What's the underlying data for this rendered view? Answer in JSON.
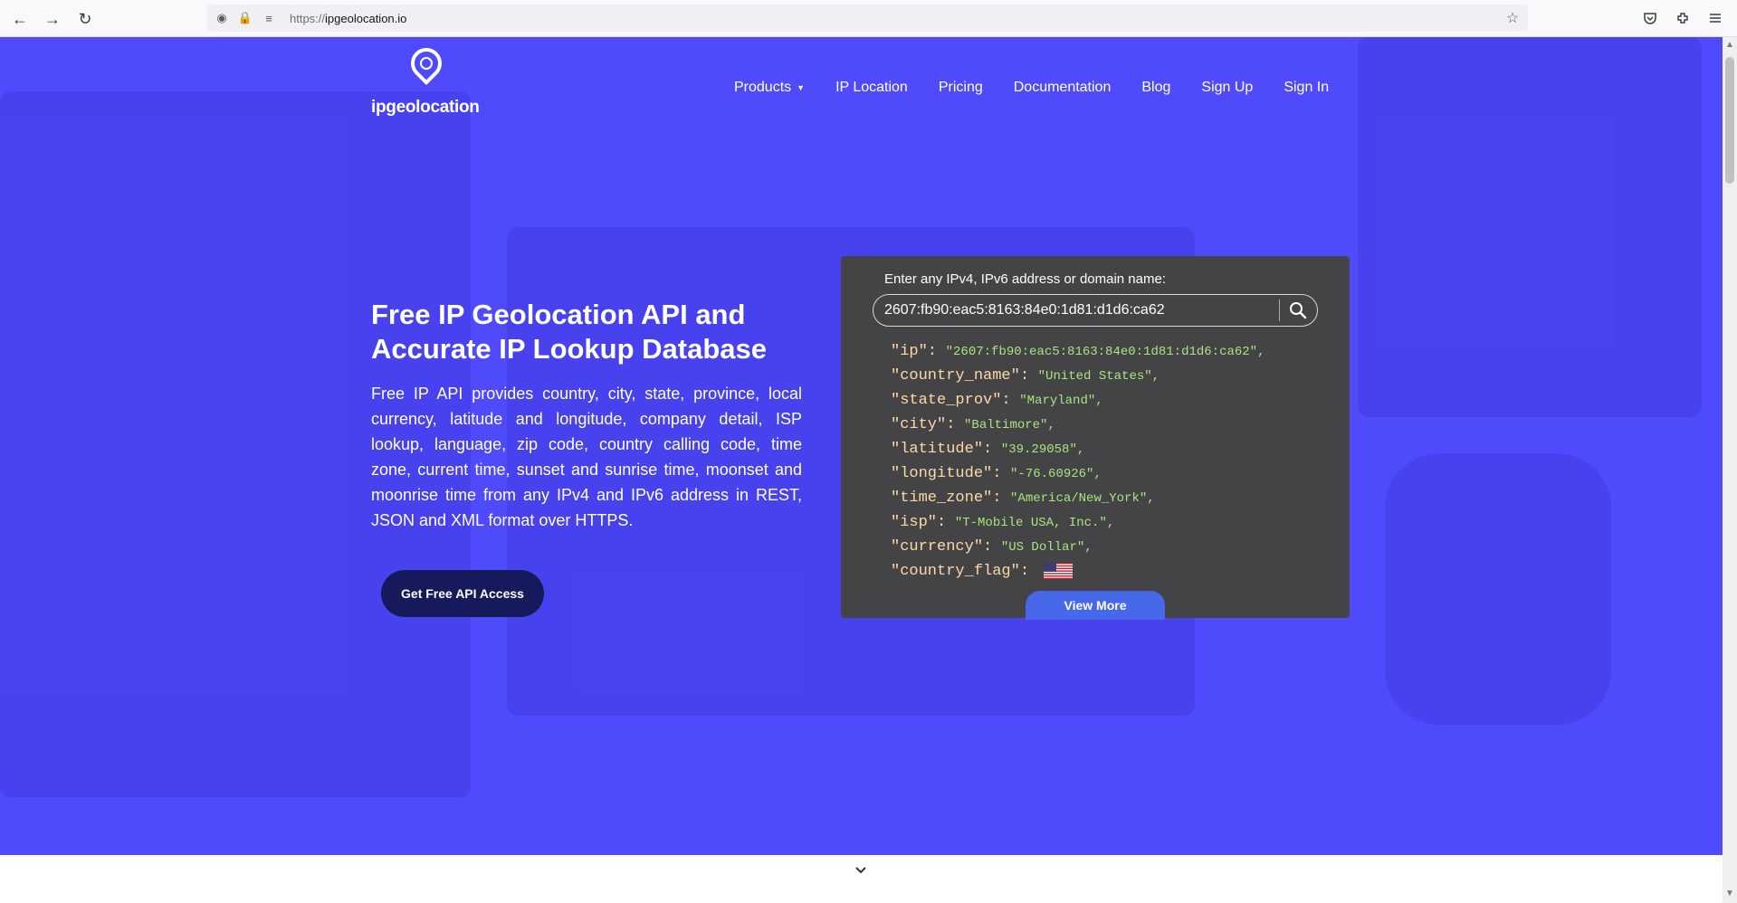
{
  "browser": {
    "url_protocol": "https://",
    "url_domain": "ipgeolocation.io",
    "icons": [
      "back-icon",
      "forward-icon",
      "reload-icon",
      "shield-icon",
      "lock-icon",
      "permissions-icon",
      "bookmark-star-icon",
      "pocket-icon",
      "extensions-icon",
      "menu-icon"
    ]
  },
  "site": {
    "logo_text": "ipgeolocation",
    "nav": {
      "products": "Products",
      "ip_location": "IP Location",
      "pricing": "Pricing",
      "documentation": "Documentation",
      "blog": "Blog",
      "sign_up": "Sign Up",
      "sign_in": "Sign In"
    }
  },
  "hero": {
    "title": "Free IP Geolocation API and Accurate IP Lookup Database",
    "description": "Free IP API provides country, city, state, province, local currency, latitude and longitude, company detail, ISP lookup, language, zip code, country calling code, time zone, current time, sunset and sunrise time, moonset and moonrise time from any IPv4 and IPv6 address in REST, JSON and XML format over HTTPS.",
    "cta_label": "Get Free API Access"
  },
  "lookup": {
    "label": "Enter any IPv4, IPv6 address or domain name:",
    "value": "2607:fb90:eac5:8163:84e0:1d81:d1d6:ca62",
    "result": [
      {
        "key": "\"ip\":",
        "value": "\"2607:fb90:eac5:8163:84e0:1d81:d1d6:ca62\","
      },
      {
        "key": "\"country_name\":",
        "value": "\"United States\","
      },
      {
        "key": "\"state_prov\":",
        "value": "\"Maryland\","
      },
      {
        "key": "\"city\":",
        "value": "\"Baltimore\","
      },
      {
        "key": "\"latitude\":",
        "value": "\"39.29058\","
      },
      {
        "key": "\"longitude\":",
        "value": "\"-76.60926\","
      },
      {
        "key": "\"time_zone\":",
        "value": "\"America/New_York\","
      },
      {
        "key": "\"isp\":",
        "value": "\"T-Mobile USA, Inc.\","
      },
      {
        "key": "\"currency\":",
        "value": "\"US Dollar\","
      },
      {
        "key": "\"country_flag\":",
        "value": ""
      }
    ],
    "view_more": "View More"
  },
  "colors": {
    "hero_bg": "#4f4afc",
    "panel_bg": "#444447",
    "cta_bg": "#141a5c",
    "view_more_bg": "#4768eb",
    "json_key": "#fdd9a8",
    "json_value": "#a8e47f"
  }
}
